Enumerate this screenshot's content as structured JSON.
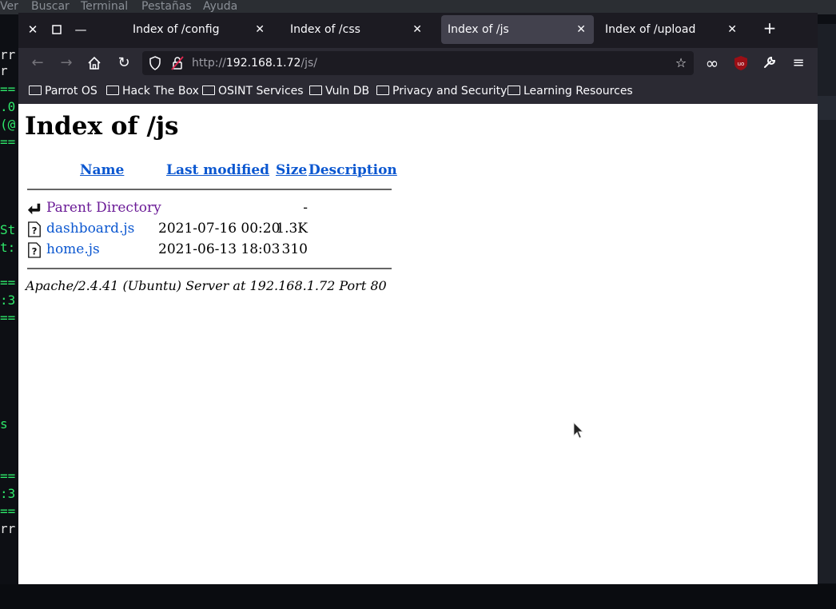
{
  "terminal": {
    "menu": [
      "Ver",
      "Buscar",
      "Terminal",
      "Pestañas",
      "Ayuda"
    ],
    "lines": [
      "rr",
      "r",
      "==",
      ".0",
      "(@",
      "==",
      "St",
      "t:",
      "==",
      ":3",
      "==",
      "s",
      "==",
      ":3",
      "==",
      "rr"
    ]
  },
  "browser": {
    "tabs": [
      {
        "title": "Index of /config"
      },
      {
        "title": "Index of /css"
      },
      {
        "title": "Index of /js"
      },
      {
        "title": "Index of /upload"
      }
    ],
    "url_prefix": "http://",
    "url_host": "192.168.1.72",
    "url_path": "/js/",
    "bookmarks": [
      "Parrot OS",
      "Hack The Box",
      "OSINT Services",
      "Vuln DB",
      "Privacy and Security",
      "Learning Resources"
    ]
  },
  "page": {
    "heading": "Index of /js",
    "columns": {
      "name": "Name",
      "modified": "Last modified",
      "size": "Size",
      "description": "Description"
    },
    "rows": [
      {
        "name": "Parent Directory",
        "modified": "",
        "size": "-"
      },
      {
        "name": "dashboard.js",
        "modified": "2021-07-16 00:20",
        "size": "1.3K"
      },
      {
        "name": "home.js",
        "modified": "2021-06-13 18:03",
        "size": "310"
      }
    ],
    "footer": "Apache/2.4.41 (Ubuntu) Server at 192.168.1.72 Port 80"
  }
}
